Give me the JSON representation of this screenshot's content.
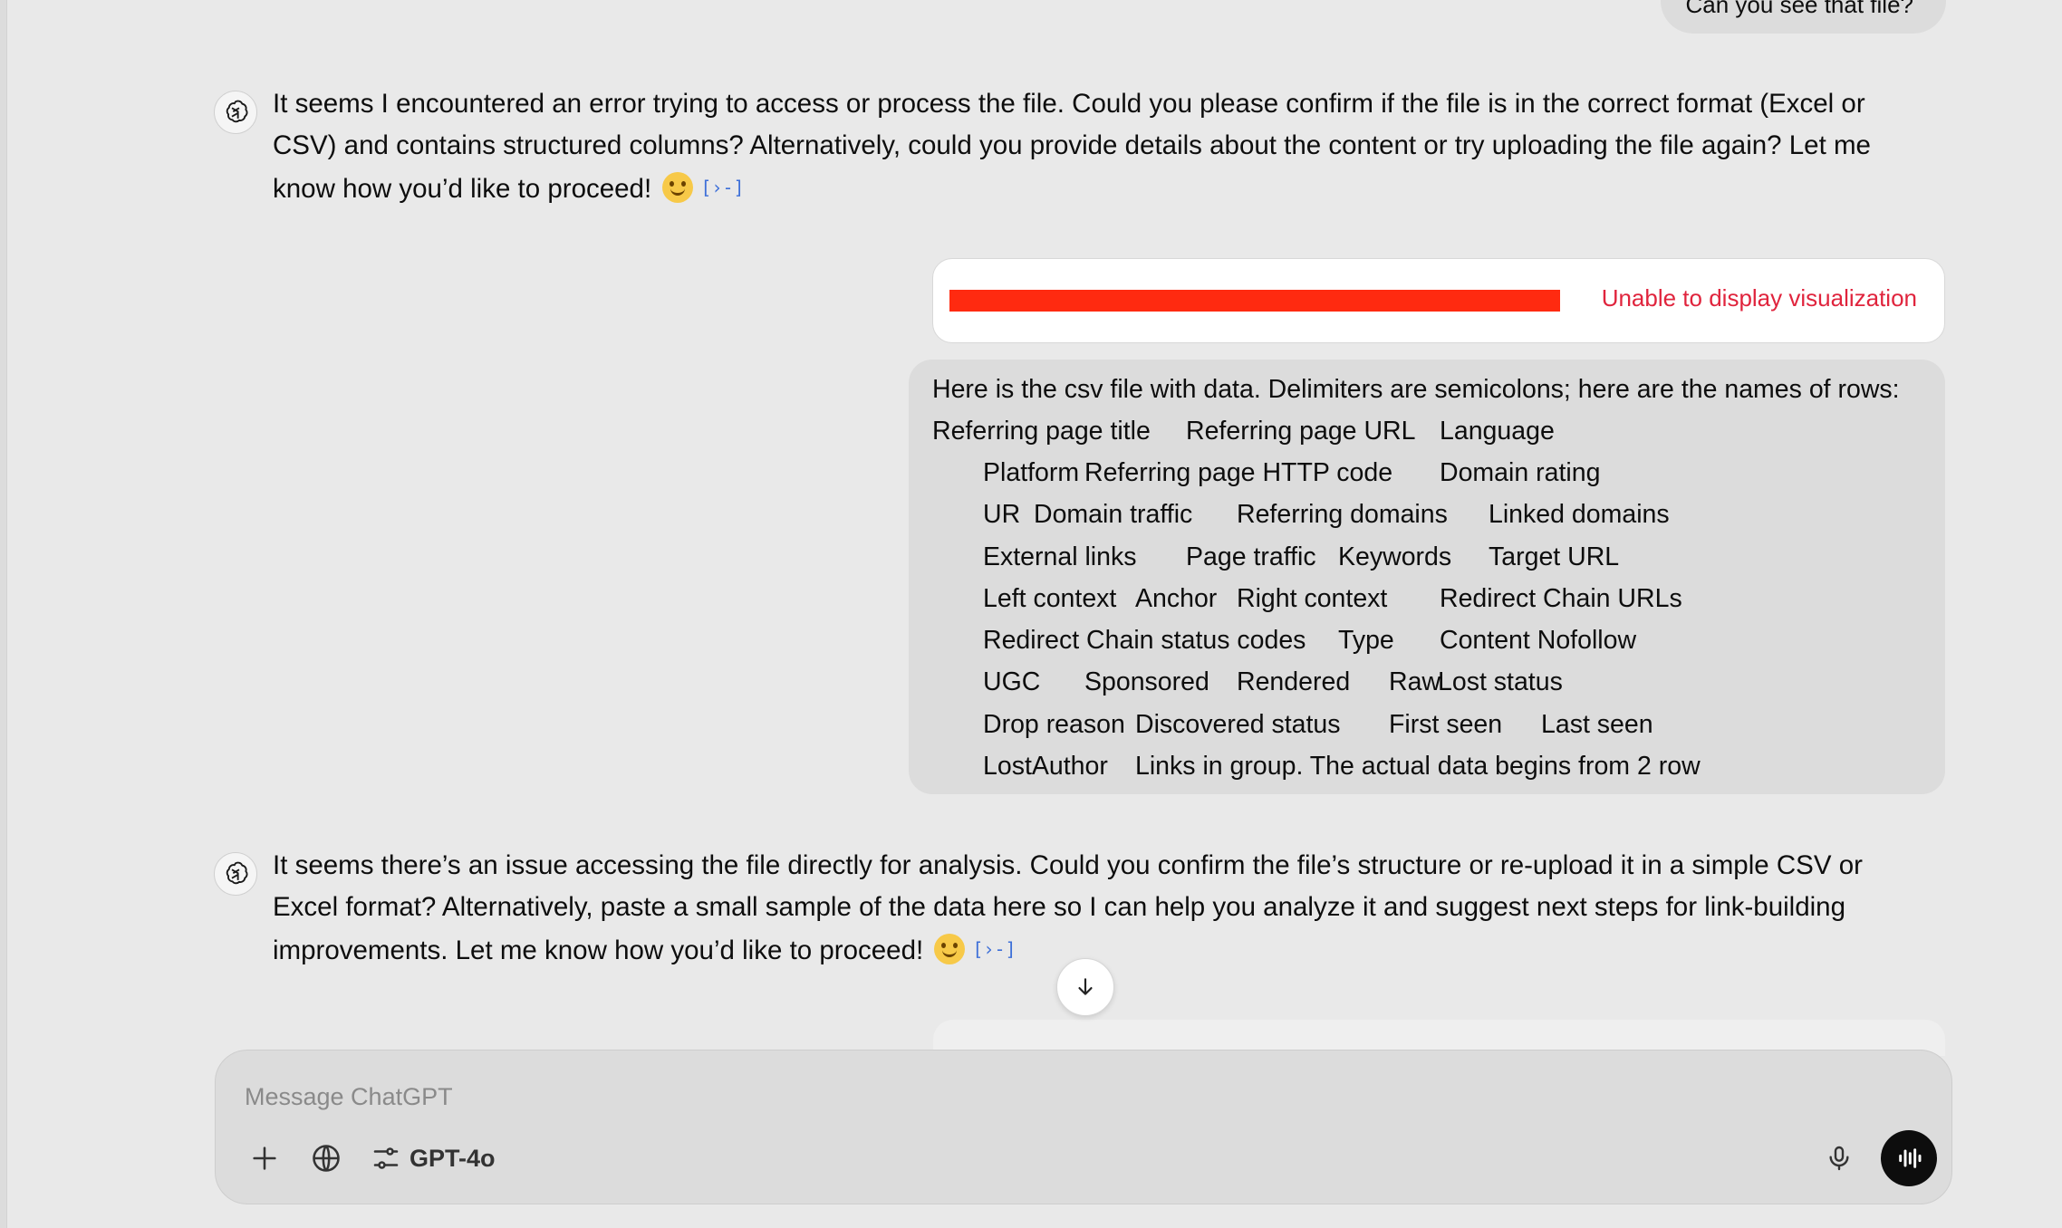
{
  "chat": {
    "user_top_text": "Can you see that file?",
    "assistant_1": "It seems I encountered an error trying to access or process the file. Could you please confirm if the file is in the correct format (Excel or CSV) and contains structured columns? Alternatively, could you provide details about the content or try uploading the file again? Let me know how you’d like to proceed! ",
    "viz_error": "Unable to display visualization",
    "csv_intro": "Here is the csv file with data. Delimiters are semicolons; here are the names of rows:",
    "csv_rows": [
      [
        "Referring page title",
        "Referring page URL",
        "Language"
      ],
      [
        "Platform",
        "Referring page HTTP code",
        "Domain rating"
      ],
      [
        "UR",
        "Domain traffic",
        "Referring domains",
        "Linked domains"
      ],
      [
        "External links",
        "Page traffic",
        "Keywords",
        "Target URL"
      ],
      [
        "Left context",
        "Anchor",
        "Right context",
        "Redirect Chain URLs"
      ],
      [
        "Redirect Chain status codes",
        "Type",
        "Content Nofollow"
      ],
      [
        "UGC",
        "Sponsored",
        "Rendered",
        "Raw",
        "Lost status"
      ],
      [
        "Drop reason",
        "Discovered status",
        "First seen",
        "Last seen"
      ],
      [
        "LostAuthor",
        "Links in group. The actual data begins from 2 row"
      ]
    ],
    "assistant_2": "It seems there’s an issue accessing the file directly for analysis. Could you confirm the file’s structure or re-upload it in a simple CSV or Excel format? Alternatively, paste a small sample of the data here so I can help you analyze it and suggest next steps for link-building improvements. Let me know how you’d like to proceed! "
  },
  "composer": {
    "placeholder": "Message ChatGPT",
    "model": "GPT-4o"
  },
  "icons": {
    "assistant_avatar": "openai-logo-icon",
    "citation": "citation-icon",
    "scroll": "arrow-down-icon",
    "attach": "plus-icon",
    "search": "globe-icon",
    "tools": "sliders-icon",
    "mic": "microphone-icon",
    "voice": "voice-mode-icon"
  },
  "colors": {
    "error_text": "#e0243d",
    "redaction": "#ff2a10",
    "background": "#e9e9e9"
  }
}
